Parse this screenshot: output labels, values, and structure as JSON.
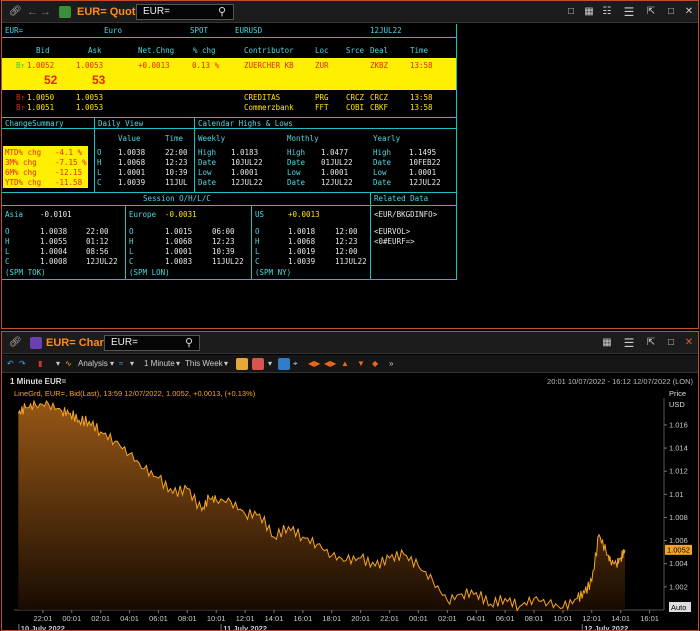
{
  "quote": {
    "title": "EUR= Quote",
    "search_value": "EUR=",
    "header": {
      "ric": "EUR=",
      "name": "Euro",
      "type": "SPOT",
      "pair": "EURUSD",
      "date": "12JUL22"
    },
    "columns": [
      "Bid",
      "Ask",
      "Net.Chng",
      "% chg",
      "Contributor",
      "Loc",
      "Srce",
      "Deal",
      "Time"
    ],
    "main_row": {
      "flag": "B↑",
      "bid": "1.0052",
      "ask": "1.0053",
      "net_chng": "+0.0013",
      "pct_chg": "0.13 %",
      "contributor": "ZUERCHER KB",
      "loc": "ZUR",
      "deal": "ZKBZ",
      "time": "13:58"
    },
    "big_bid": "52",
    "big_ask": "53",
    "rows": [
      {
        "flag": "B↑",
        "bid": "1.0050",
        "ask": "1.0053",
        "contributor": "CREDITAS",
        "loc": "PRG",
        "srce": "CRCZ",
        "deal": "CRCZ",
        "time": "13:58"
      },
      {
        "flag": "B↑",
        "bid": "1.0051",
        "ask": "1.0053",
        "contributor": "Commerzbank",
        "loc": "FFT",
        "srce": "COBI",
        "deal": "CBKF",
        "time": "13:58"
      }
    ],
    "change_summary": {
      "title": "ChangeSummary",
      "items": [
        {
          "label": "MTD% chg",
          "value": "-4.1 %"
        },
        {
          "label": "3M% chg",
          "value": "-7.15 %"
        },
        {
          "label": "6M% chg",
          "value": "-12.15"
        },
        {
          "label": "YTD% chg",
          "value": "-11.58"
        }
      ]
    },
    "daily_view": {
      "title": "Daily View",
      "col_value": "Value",
      "col_time": "Time",
      "rows": [
        {
          "k": "O",
          "v": "1.0038",
          "t": "22:00"
        },
        {
          "k": "H",
          "v": "1.0068",
          "t": "12:23"
        },
        {
          "k": "L",
          "v": "1.0001",
          "t": "10:39"
        },
        {
          "k": "C",
          "v": "1.0039",
          "t": "11JUL"
        }
      ]
    },
    "calendar": {
      "title": "Calendar Highs  & Lows",
      "weekly": {
        "title": "Weekly",
        "rows": [
          {
            "k": "High",
            "v": "1.0183"
          },
          {
            "k": "Date",
            "v": "10JUL22"
          },
          {
            "k": "Low",
            "v": "1.0001"
          },
          {
            "k": "Date",
            "v": "12JUL22"
          }
        ]
      },
      "monthly": {
        "title": "Monthly",
        "rows": [
          {
            "k": "High",
            "v": "1.0477"
          },
          {
            "k": "Date",
            "v": "01JUL22"
          },
          {
            "k": "Low",
            "v": "1.0001"
          },
          {
            "k": "Date",
            "v": "12JUL22"
          }
        ]
      },
      "yearly": {
        "title": "Yearly",
        "rows": [
          {
            "k": "High",
            "v": "1.1495"
          },
          {
            "k": "Date",
            "v": "10FEB22"
          },
          {
            "k": "Low",
            "v": "1.0001"
          },
          {
            "k": "Date",
            "v": "12JUL22"
          }
        ]
      }
    },
    "session_title": "Session O/H/L/C",
    "related_title": "Related Data",
    "sessions": [
      {
        "name": "Asia",
        "chg": "-0.0101",
        "footer": "(SPM TOK)",
        "rows": [
          {
            "k": "O",
            "v": "1.0038",
            "t": "22:00"
          },
          {
            "k": "H",
            "v": "1.0055",
            "t": "01:12"
          },
          {
            "k": "L",
            "v": "1.0004",
            "t": "08:56"
          },
          {
            "k": "C",
            "v": "1.0008",
            "t": "12JUL22"
          }
        ]
      },
      {
        "name": "Europe",
        "chg": "-0.0031",
        "footer": "(SPM LON)",
        "rows": [
          {
            "k": "O",
            "v": "1.0015",
            "t": "06:00"
          },
          {
            "k": "H",
            "v": "1.0068",
            "t": "12:23"
          },
          {
            "k": "L",
            "v": "1.0001",
            "t": "10:39"
          },
          {
            "k": "C",
            "v": "1.0083",
            "t": "11JUL22"
          }
        ]
      },
      {
        "name": "US",
        "chg": "+0.0013",
        "footer": "(SPM NY)",
        "rows": [
          {
            "k": "O",
            "v": "1.0018",
            "t": "12:00"
          },
          {
            "k": "H",
            "v": "1.0068",
            "t": "12:23"
          },
          {
            "k": "L",
            "v": "1.0019",
            "t": "12:00"
          },
          {
            "k": "C",
            "v": "1.0039",
            "t": "11JUL22"
          }
        ]
      }
    ],
    "related_links": [
      "<EUR/BKGDINFO>",
      "<EURVOL>",
      "<0#EURF=>"
    ]
  },
  "chart": {
    "title": "EUR= Chart",
    "search_value": "EUR=",
    "toolbar": {
      "analysis": "Analysis",
      "interval": "1 Minute",
      "range": "This Week"
    },
    "chart_title": "1 Minute EUR=",
    "date_range": "20:01 10/07/2022 - 16:12 12/07/2022 (LON)",
    "legend": "LineGrd, EUR=, Bid(Last), 13:59 12/07/2022, 1.0052, +0.0013, (+0.13%)",
    "price_label": "Price",
    "currency_label": "USD",
    "last_value_label": "1.0052",
    "auto_label": "Auto",
    "accent": "#f5a524"
  },
  "chart_data": {
    "type": "area",
    "title": "1 Minute EUR=",
    "ylabel": "Price USD",
    "ylim": [
      1.0,
      1.0185
    ],
    "y_ticks": [
      "1.016",
      "1.014",
      "1.012",
      "1.01",
      "1.008",
      "1.006",
      "1.004",
      "1.002"
    ],
    "y_tick_values": [
      1.016,
      1.014,
      1.012,
      1.01,
      1.008,
      1.006,
      1.004,
      1.002
    ],
    "x_ticks": [
      "22:01",
      "00:01",
      "02:01",
      "04:01",
      "06:01",
      "08:01",
      "10:01",
      "12:01",
      "14:01",
      "16:01",
      "18:01",
      "20:01",
      "22:01",
      "00:01",
      "02:01",
      "04:01",
      "06:01",
      "08:01",
      "10:01",
      "12:01",
      "14:01",
      "16:01"
    ],
    "x_tick_hours": [
      2,
      4,
      6,
      8,
      10,
      12,
      14,
      16,
      18,
      20,
      22,
      24,
      26,
      28,
      30,
      32,
      34,
      36,
      38,
      40,
      42,
      44
    ],
    "x_range_hours": [
      0,
      45
    ],
    "date_labels": [
      {
        "text": "10 July 2022",
        "at": 2
      },
      {
        "text": "11 July 2022",
        "at": 16
      },
      {
        "text": "12 July 2022",
        "at": 41
      }
    ],
    "series": [
      {
        "x": [
          0.3,
          0.8,
          1.5,
          2.4,
          3.3,
          3.9,
          4.5,
          5.2,
          6.0,
          7.0,
          8.0,
          9.0,
          10.0,
          11.0,
          12.0,
          13.0,
          13.5,
          14.0,
          15.0,
          16.0,
          17.0,
          18.0,
          19.0,
          20.0,
          21.0,
          22.0,
          23.0,
          24.0,
          25.0,
          26.0,
          27.0,
          28.0,
          29.0,
          30.0,
          31.0,
          32.0,
          33.0,
          34.0,
          35.0,
          36.0,
          37.0,
          38.0,
          39.0,
          39.5,
          40.0,
          40.5,
          41.0,
          41.3,
          41.7,
          42.0,
          42.3
        ],
        "values": [
          1.017,
          1.0175,
          1.0177,
          1.0178,
          1.0172,
          1.017,
          1.0164,
          1.0163,
          1.0154,
          1.0146,
          1.0135,
          1.0122,
          1.0114,
          1.0101,
          1.0105,
          1.0086,
          1.0097,
          1.0095,
          1.0094,
          1.0083,
          1.0083,
          1.0063,
          1.0072,
          1.0063,
          1.0057,
          1.0047,
          1.0043,
          1.0045,
          1.0038,
          1.0045,
          1.0048,
          1.0038,
          1.0025,
          1.0008,
          1.0014,
          1.0015,
          1.0005,
          1.001,
          1.0003,
          1.001,
          1.0006,
          1.0002,
          1.001,
          1.0015,
          1.0025,
          1.0065,
          1.005,
          1.0042,
          1.004,
          1.0045,
          1.0052
        ]
      }
    ]
  }
}
